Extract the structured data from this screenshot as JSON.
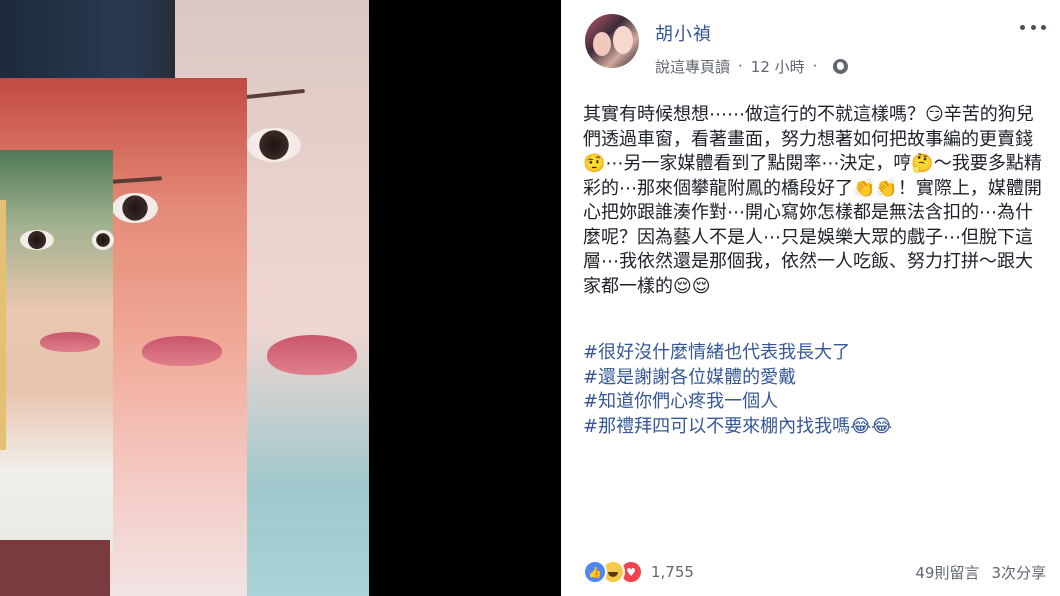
{
  "post": {
    "author": "胡小禎",
    "meta_source": "說這專頁讀",
    "meta_time": "12 小時",
    "body": "其實有時候想想⋯⋯做這行的不就這樣嗎？😏辛苦的狗兒們透過車窗，看著畫面，努力想著如何把故事編的更賣錢🤨⋯另一家媒體看到了點閱率⋯決定，哼🤔～我要多點精彩的⋯那來個攀龍附鳳的橋段好了👏👏！實際上，媒體開心把妳跟誰湊作對⋯開心寫妳怎樣都是無法含扣的⋯為什麼呢？因為藝人不是人⋯只是娛樂大眾的戲子⋯但脫下這層⋯我依然還是那個我，依然一人吃飯、努力打拼～跟大家都一樣的😌😌",
    "hashtags": [
      "#很好沒什麼情緒也代表我長大了",
      "#還是謝謝各位媒體的愛戴",
      "#知道你們心疼我一個人",
      "#那禮拜四可以不要來棚內找我嗎😂😂"
    ],
    "reaction_count": "1,755",
    "comments": "49則留言",
    "shares": "3次分享"
  },
  "icons": {
    "privacy": "globe-icon",
    "menu": "more-options-icon",
    "reactions": [
      "like-icon",
      "haha-icon",
      "love-icon"
    ]
  },
  "colors": {
    "link": "#365899",
    "text": "#1d2129",
    "meta": "#616770"
  }
}
